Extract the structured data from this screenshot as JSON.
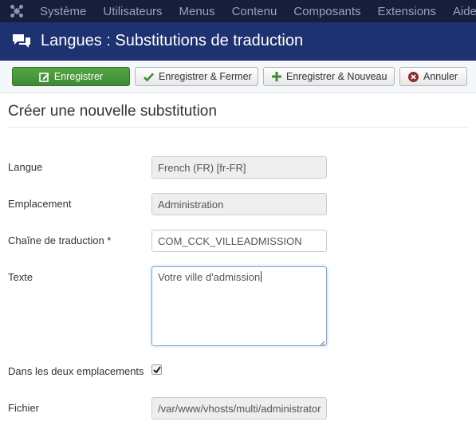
{
  "topnav": {
    "logo_icon": "joomla-logo-icon",
    "items": [
      {
        "label": "Système"
      },
      {
        "label": "Utilisateurs"
      },
      {
        "label": "Menus"
      },
      {
        "label": "Contenu"
      },
      {
        "label": "Composants"
      },
      {
        "label": "Extensions"
      },
      {
        "label": "Aide"
      }
    ]
  },
  "header": {
    "icon": "comments-icon",
    "title": "Langues : Substitutions de traduction"
  },
  "toolbar": {
    "save_label": "Enregistrer",
    "save_close_label": "Enregistrer & Fermer",
    "save_new_label": "Enregistrer & Nouveau",
    "cancel_label": "Annuler",
    "colors": {
      "save_bg": "#469336",
      "check": "#3f8a33",
      "plus": "#3f8a33",
      "cancel": "#8b2c2c"
    }
  },
  "form": {
    "title": "Créer une nouvelle substitution",
    "fields": {
      "language": {
        "label": "Langue",
        "value": "French (FR) [fr-FR]"
      },
      "location": {
        "label": "Emplacement",
        "value": "Administration"
      },
      "key": {
        "label": "Chaîne de traduction *",
        "value": "COM_CCK_VILLEADMISSION"
      },
      "text": {
        "label": "Texte",
        "value": "Votre ville d'admission"
      },
      "both": {
        "label": "Dans les deux emplacements",
        "checked": true
      },
      "file": {
        "label": "Fichier",
        "value": "/var/www/vhosts/multi/administrator"
      }
    }
  }
}
